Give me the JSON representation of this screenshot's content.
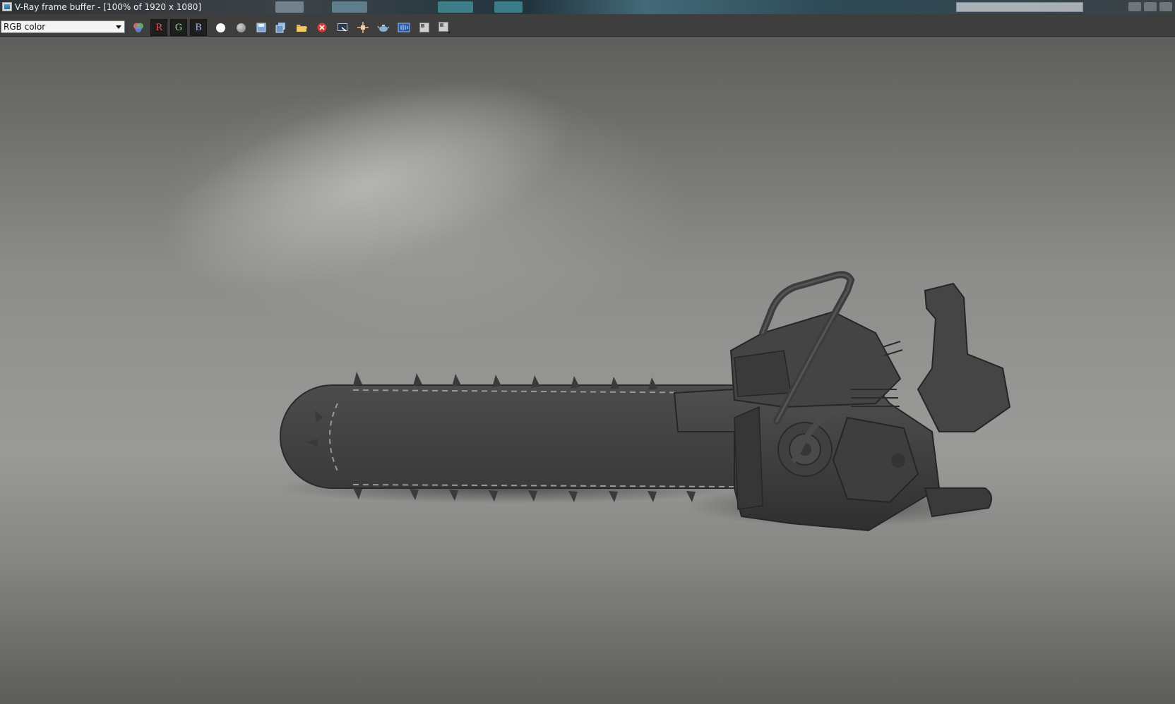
{
  "window": {
    "title": "V-Ray frame buffer - [100% of 1920 x 1080]"
  },
  "toolbar": {
    "channel_select_value": "RGB color",
    "red_label": "R",
    "green_label": "G",
    "blue_label": "B"
  },
  "icons": [
    "color-channels-icon",
    "red-channel-button",
    "green-channel-button",
    "blue-channel-button",
    "white-dot-icon",
    "gray-dot-icon",
    "save-icon",
    "save-all-icon",
    "open-icon",
    "clear-icon",
    "region-render-icon",
    "track-mouse-icon",
    "teapot-render-icon",
    "lens-effects-icon",
    "compare-a-icon",
    "compare-b-icon"
  ],
  "colors": {
    "toolbar_bg": "#3e3e3e",
    "render_bg": "#8c8d8a",
    "red_channel": "#e45a5a",
    "green_channel": "#9ad49a",
    "blue_channel": "#a8b8e8"
  }
}
